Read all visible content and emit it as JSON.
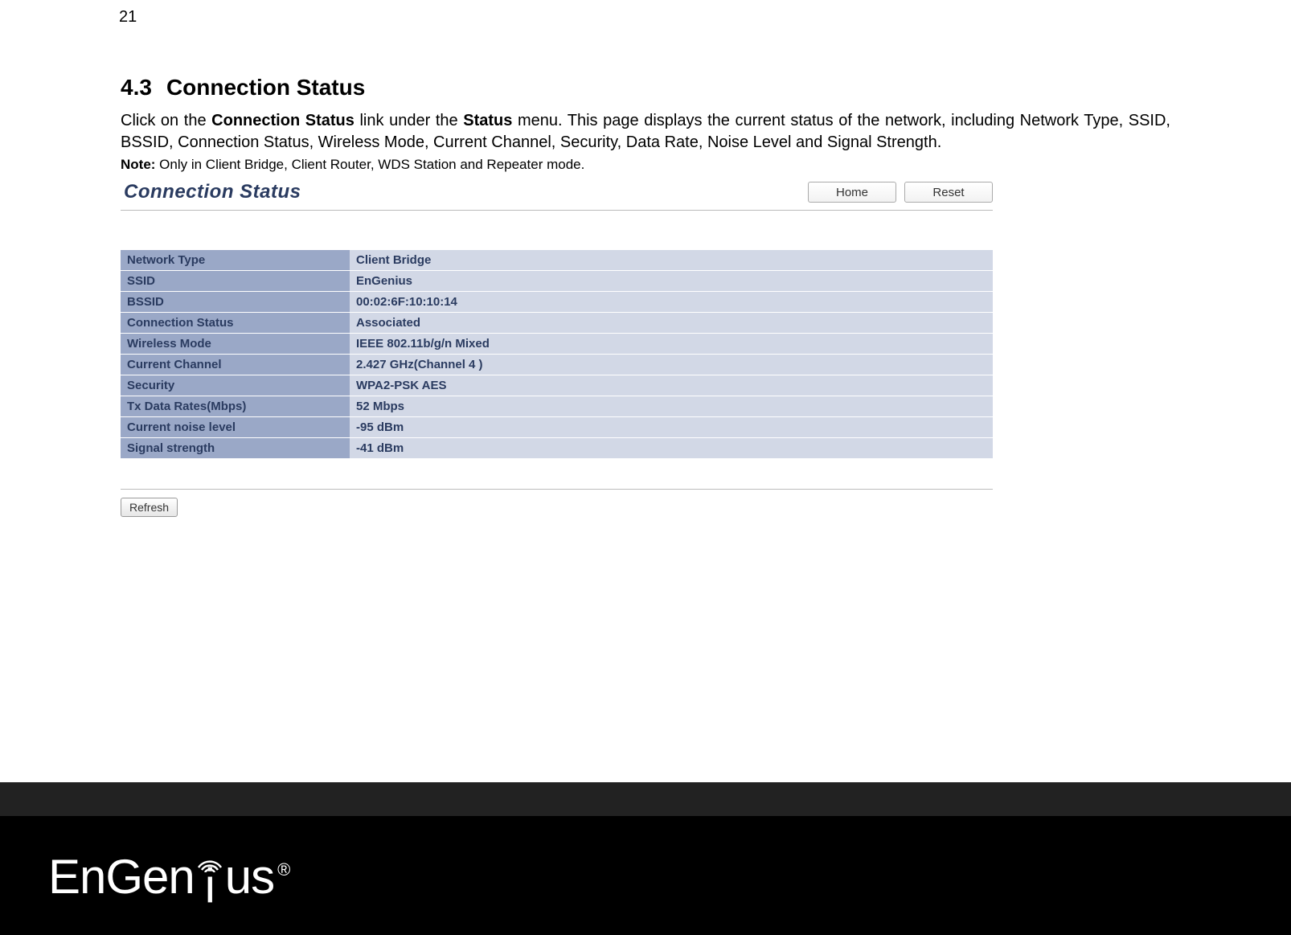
{
  "page_number": "21",
  "heading": {
    "number": "4.3",
    "title": "Connection Status"
  },
  "body": {
    "p1_a": "Click on the ",
    "p1_b": "Connection Status",
    "p1_c": " link under the ",
    "p1_d": "Status",
    "p1_e": " menu. This page displays the current status of the network, including Network Type, SSID, BSSID, Connection Status, Wireless Mode, Current Channel, Security, Data Rate, Noise Level and Signal Strength."
  },
  "note": {
    "label": "Note:",
    "text": " Only in Client Bridge, Client Router, WDS Station and Repeater mode."
  },
  "ui": {
    "title": "Connection Status",
    "home_btn": "Home",
    "reset_btn": "Reset",
    "refresh_btn": "Refresh",
    "rows": [
      {
        "label": "Network Type",
        "value": "Client Bridge"
      },
      {
        "label": "SSID",
        "value": "EnGenius"
      },
      {
        "label": "BSSID",
        "value": "00:02:6F:10:10:14"
      },
      {
        "label": "Connection Status",
        "value": "Associated"
      },
      {
        "label": "Wireless Mode",
        "value": "IEEE 802.11b/g/n Mixed"
      },
      {
        "label": "Current Channel",
        "value": "2.427 GHz(Channel 4 )"
      },
      {
        "label": "Security",
        "value": "WPA2-PSK AES"
      },
      {
        "label": "Tx Data Rates(Mbps)",
        "value": "52 Mbps"
      },
      {
        "label": "Current noise level",
        "value": "-95 dBm"
      },
      {
        "label": "Signal strength",
        "value": "-41 dBm"
      }
    ]
  },
  "footer": {
    "brand_part1": "EnGen",
    "brand_i": "i",
    "brand_part2": "us",
    "reg": "®"
  }
}
